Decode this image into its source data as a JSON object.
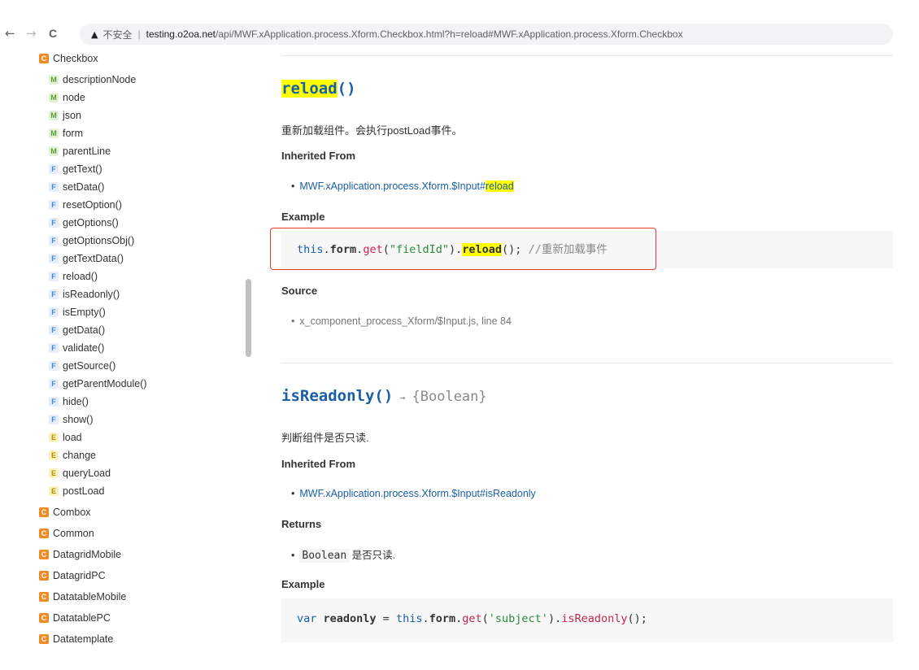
{
  "browser": {
    "back": "←",
    "forward": "→",
    "reload": "C",
    "security_icon": "warning-triangle-icon",
    "security_label": "不安全",
    "url_host": "testing.o2oa.net",
    "url_path": "/api/MWF.xApplication.process.Xform.Checkbox.html?h=reload#MWF.xApplication.process.Xform.Checkbox"
  },
  "sidebar": {
    "items": [
      {
        "badge": "C",
        "label": "Checkbox",
        "kind": "class"
      },
      {
        "badge": "M",
        "label": "descriptionNode",
        "kind": "member"
      },
      {
        "badge": "M",
        "label": "node",
        "kind": "member"
      },
      {
        "badge": "M",
        "label": "json",
        "kind": "member"
      },
      {
        "badge": "M",
        "label": "form",
        "kind": "member"
      },
      {
        "badge": "M",
        "label": "parentLine",
        "kind": "member"
      },
      {
        "badge": "F",
        "label": "getText()",
        "kind": "function"
      },
      {
        "badge": "F",
        "label": "setData()",
        "kind": "function"
      },
      {
        "badge": "F",
        "label": "resetOption()",
        "kind": "function"
      },
      {
        "badge": "F",
        "label": "getOptions()",
        "kind": "function"
      },
      {
        "badge": "F",
        "label": "getOptionsObj()",
        "kind": "function"
      },
      {
        "badge": "F",
        "label": "getTextData()",
        "kind": "function"
      },
      {
        "badge": "F",
        "label": "reload()",
        "kind": "function"
      },
      {
        "badge": "F",
        "label": "isReadonly()",
        "kind": "function"
      },
      {
        "badge": "F",
        "label": "isEmpty()",
        "kind": "function"
      },
      {
        "badge": "F",
        "label": "getData()",
        "kind": "function"
      },
      {
        "badge": "F",
        "label": "validate()",
        "kind": "function"
      },
      {
        "badge": "F",
        "label": "getSource()",
        "kind": "function"
      },
      {
        "badge": "F",
        "label": "getParentModule()",
        "kind": "function"
      },
      {
        "badge": "F",
        "label": "hide()",
        "kind": "function"
      },
      {
        "badge": "F",
        "label": "show()",
        "kind": "function"
      },
      {
        "badge": "E",
        "label": "load",
        "kind": "event"
      },
      {
        "badge": "E",
        "label": "change",
        "kind": "event"
      },
      {
        "badge": "E",
        "label": "queryLoad",
        "kind": "event"
      },
      {
        "badge": "E",
        "label": "postLoad",
        "kind": "event"
      },
      {
        "badge": "C",
        "label": "Combox",
        "kind": "class"
      },
      {
        "badge": "C",
        "label": "Common",
        "kind": "class"
      },
      {
        "badge": "C",
        "label": "DatagridMobile",
        "kind": "class"
      },
      {
        "badge": "C",
        "label": "DatagridPC",
        "kind": "class"
      },
      {
        "badge": "C",
        "label": "DatatableMobile",
        "kind": "class"
      },
      {
        "badge": "C",
        "label": "DatatablePC",
        "kind": "class"
      },
      {
        "badge": "C",
        "label": "Datatemplate",
        "kind": "class"
      }
    ]
  },
  "reload": {
    "name": "reload",
    "parens": "()",
    "description": "重新加载组件。会执行postLoad事件。",
    "inherited_heading": "Inherited From",
    "inherited_link_prefix": "MWF.xApplication.process.Xform.$Input#",
    "inherited_link_hl": "reload",
    "example_heading": "Example",
    "code": {
      "t1": "this",
      "t2": ".",
      "t3": "form",
      "t4": ".",
      "t5": "get",
      "t6": "(",
      "t7": "\"fieldId\"",
      "t8": ").",
      "t9": "reload",
      "t10": "(); ",
      "t11": "//重新加载事件"
    },
    "source_heading": "Source",
    "source_text": "x_component_process_Xform/$Input.js, line 84"
  },
  "isReadonly": {
    "name": "isReadonly()",
    "arrow": "→",
    "return_type": "{Boolean}",
    "description": "判断组件是否只读.",
    "inherited_heading": "Inherited From",
    "inherited_link": "MWF.xApplication.process.Xform.$Input#isReadonly",
    "returns_heading": "Returns",
    "returns_type": "Boolean",
    "returns_desc": " 是否只读.",
    "example_heading": "Example",
    "code": {
      "t1": "var",
      "t2": " readonly",
      "t3": " = ",
      "t4": "this",
      "t5": ".",
      "t6": "form",
      "t7": ".",
      "t8": "get",
      "t9": "(",
      "t10": "'subject'",
      "t11": ").",
      "t12": "isReadonly",
      "t13": "();"
    }
  }
}
